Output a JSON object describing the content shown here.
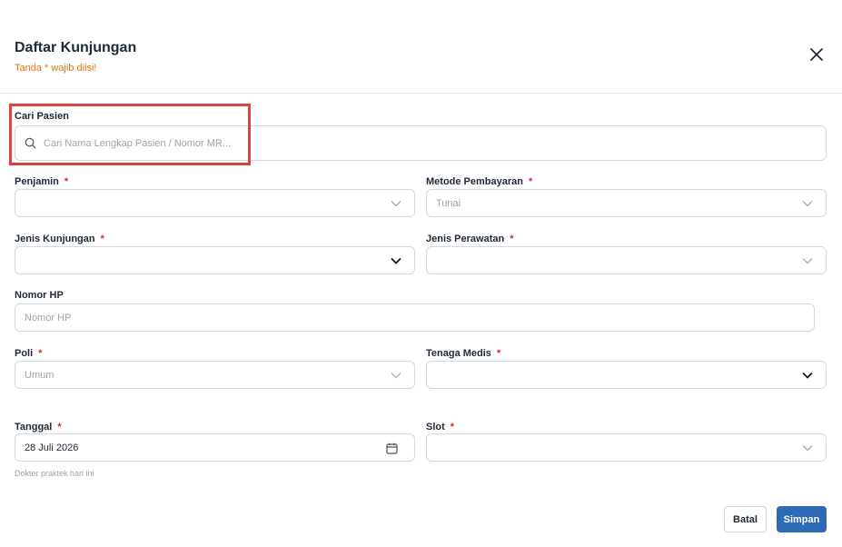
{
  "dialog": {
    "title": "Daftar Kunjungan",
    "subtitle": "Tanda * wajib diisi!"
  },
  "search": {
    "label": "Cari Pasien",
    "placeholder": "Cari Nama Lengkap Pasien / Nomor MR..."
  },
  "fields": {
    "penjamin": {
      "label": "Penjamin",
      "required": "*",
      "value": ""
    },
    "metode_pembayaran": {
      "label": "Metode Pembayaran",
      "required": "*",
      "value": "Tunai"
    },
    "jenis_kunjungan": {
      "label": "Jenis Kunjungan",
      "required": "*",
      "value": ""
    },
    "jenis_perawatan": {
      "label": "Jenis Perawatan",
      "required": "*",
      "value": ""
    },
    "nomor_hp": {
      "label": "Nomor HP",
      "placeholder": "Nomor HP"
    },
    "poli": {
      "label": "Poli",
      "required": "*",
      "value": "Umum"
    },
    "tenaga_medis": {
      "label": "Tenaga Medis",
      "required": "*",
      "value": ""
    },
    "tanggal": {
      "label": "Tanggal",
      "required": "*",
      "value": "28 Juli 2026",
      "hint": "Dokter praktek hari ini"
    },
    "slot": {
      "label": "Slot",
      "required": "*",
      "value": ""
    }
  },
  "actions": {
    "cancel_label": "Batal",
    "save_label": "Simpan"
  },
  "colors": {
    "accent": "#2d6bb4",
    "required": "#dc2626",
    "warning": "#e0780e",
    "highlight": "#e0403a"
  }
}
